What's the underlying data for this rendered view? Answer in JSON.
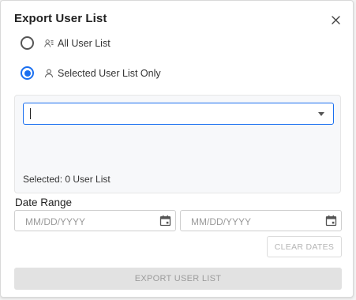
{
  "dialog": {
    "title": "Export User List",
    "close_icon": "close-icon"
  },
  "options": [
    {
      "label": "All User List",
      "icon": "user-list-icon",
      "checked": false
    },
    {
      "label": "Selected User List Only",
      "icon": "user-icon",
      "checked": true
    }
  ],
  "user_select": {
    "value": "",
    "selected_text": "Selected: 0 User List"
  },
  "date_range": {
    "label": "Date Range",
    "start_placeholder": "MM/DD/YYYY",
    "end_placeholder": "MM/DD/YYYY",
    "calendar_icon": "calendar-icon",
    "clear_label": "CLEAR DATES"
  },
  "actions": {
    "export_label": "EXPORT USER LIST"
  },
  "colors": {
    "accent": "#1a6ff0",
    "disabled_bg": "#e2e2e2",
    "panel_bg": "#f7f8fa"
  }
}
